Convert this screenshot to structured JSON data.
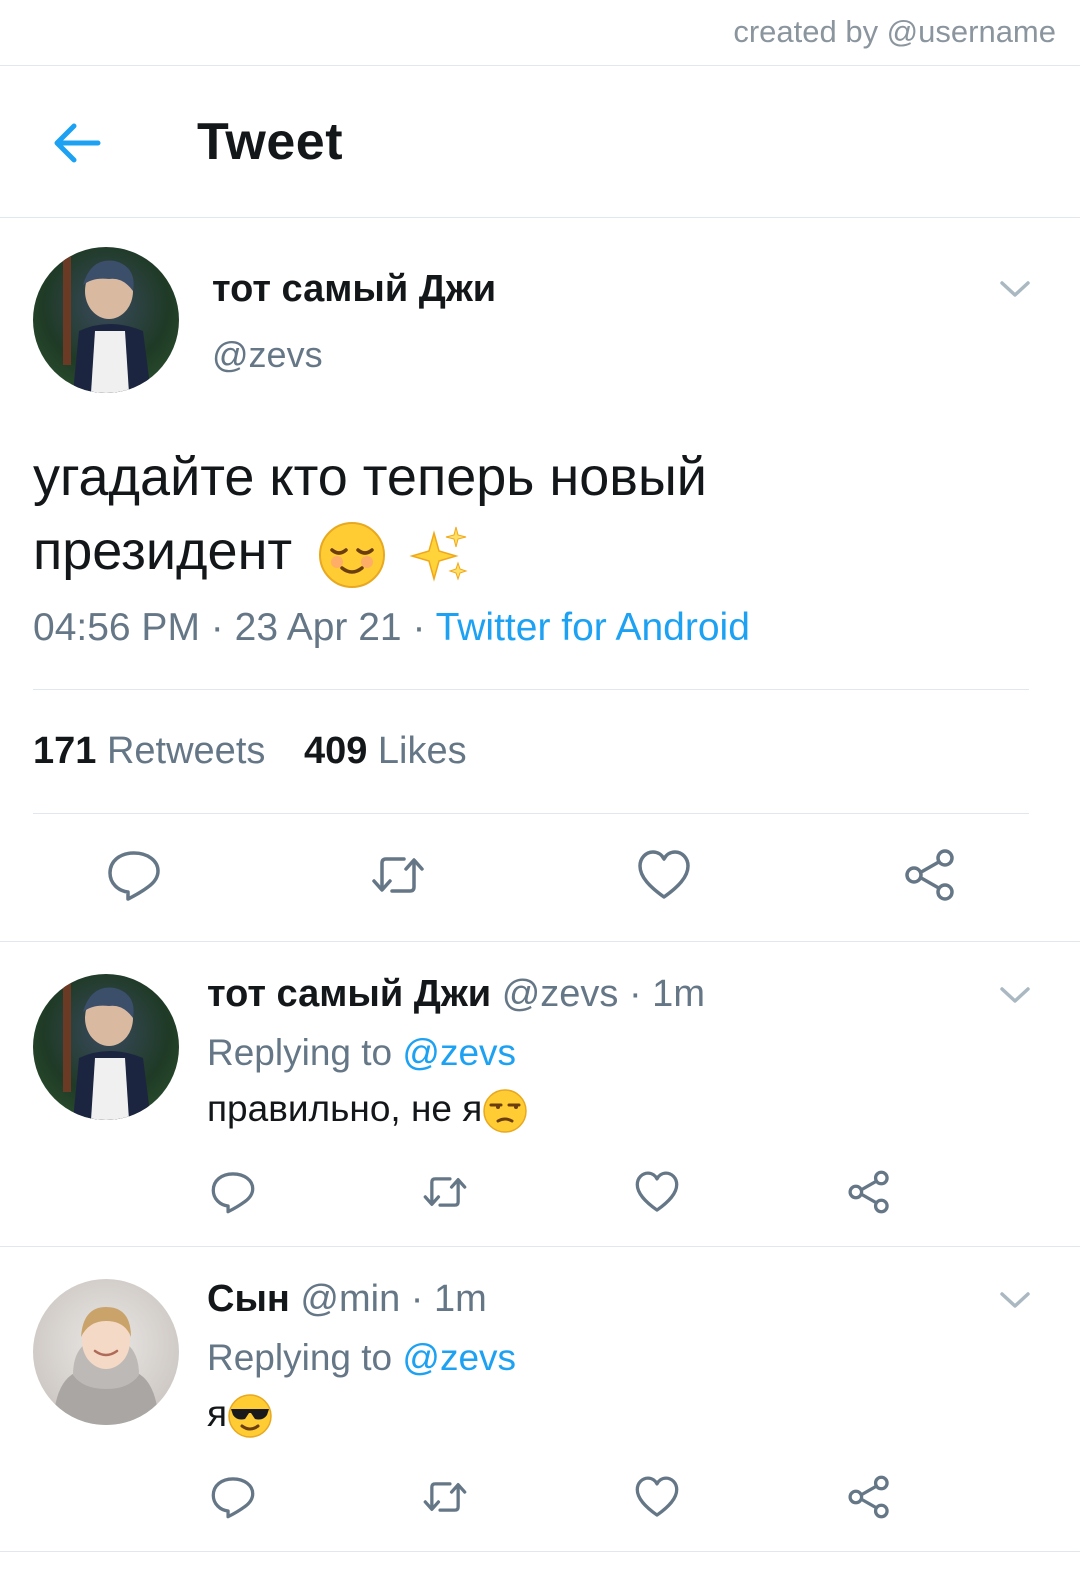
{
  "credit": "created by @username",
  "header": {
    "title": "Tweet",
    "back_icon": "arrow-left-icon"
  },
  "tweet": {
    "name": "тот самый Джи",
    "handle": "@zevs",
    "text_line1": "угадайте кто теперь новый",
    "text_line2": "президент",
    "emojis": [
      "relieved-face-emoji",
      "sparkles-emoji"
    ],
    "time": "04:56 PM",
    "sep1": "·",
    "date": "23 Apr 21",
    "sep2": "·",
    "source": "Twitter for Android",
    "retweets_count": "171",
    "retweets_label": "Retweets",
    "likes_count": "409",
    "likes_label": "Likes"
  },
  "replies": [
    {
      "name": "тот самый Джи",
      "meta": "@zevs · 1m",
      "replying_label": "Replying to",
      "replying_handle": "@zevs",
      "text": "правильно, не я",
      "emoji": "unamused-face-emoji"
    },
    {
      "name": "Сын",
      "meta": "@min · 1m",
      "replying_label": "Replying to",
      "replying_handle": "@zevs",
      "text": "я",
      "emoji": "sunglasses-face-emoji"
    }
  ],
  "colors": {
    "accent": "#1da1f2",
    "text": "#14171a",
    "secondary": "#657786",
    "divider": "#e1e8ed"
  }
}
